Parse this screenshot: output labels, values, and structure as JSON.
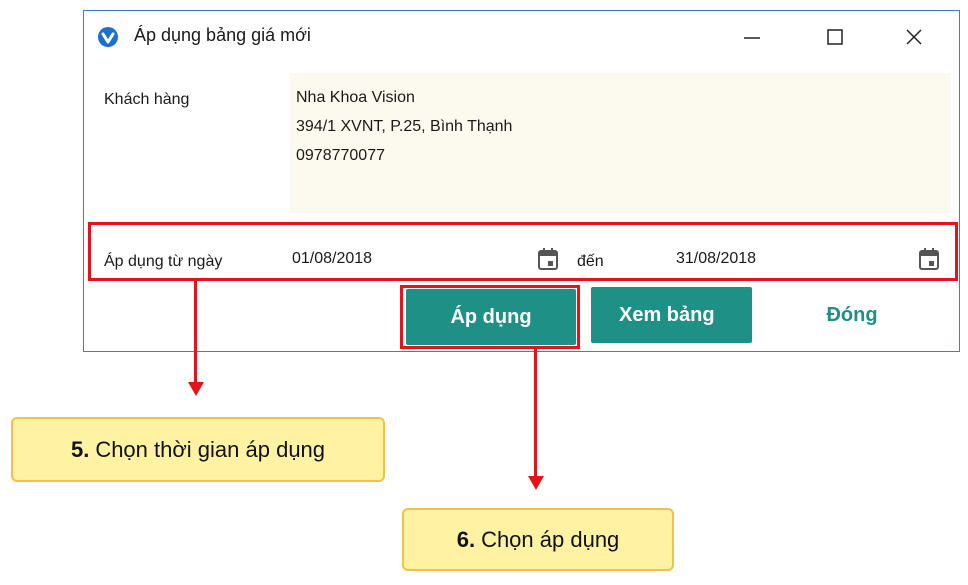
{
  "window": {
    "title": "Áp dụng bảng giá mới",
    "app_icon": "check-shield-icon",
    "controls": [
      "minimize-icon",
      "maximize-icon",
      "close-icon"
    ]
  },
  "customer": {
    "label": "Khách hàng",
    "name": "Nha Khoa Vision",
    "address": "394/1 XVNT, P.25, Bình Thạnh",
    "phone": "0978770077"
  },
  "date_range": {
    "label": "Áp dụng từ ngày",
    "from": "01/08/2018",
    "to_label": "đến",
    "to": "31/08/2018",
    "icon": "calendar-icon"
  },
  "buttons": {
    "apply": "Áp dụng",
    "view": "Xem bảng",
    "close": "Đóng"
  },
  "annotations": {
    "step5_num": "5.",
    "step5_text": "Chọn thời gian áp dụng",
    "step6_num": "6.",
    "step6_text": "Chọn áp dụng"
  },
  "colors": {
    "accent": "#1e9086",
    "highlight": "#e3141c",
    "callout_bg": "#fff3a3",
    "callout_border": "#f2c14b",
    "window_border": "#3c7fd1",
    "input_bg": "#fcfaee"
  }
}
